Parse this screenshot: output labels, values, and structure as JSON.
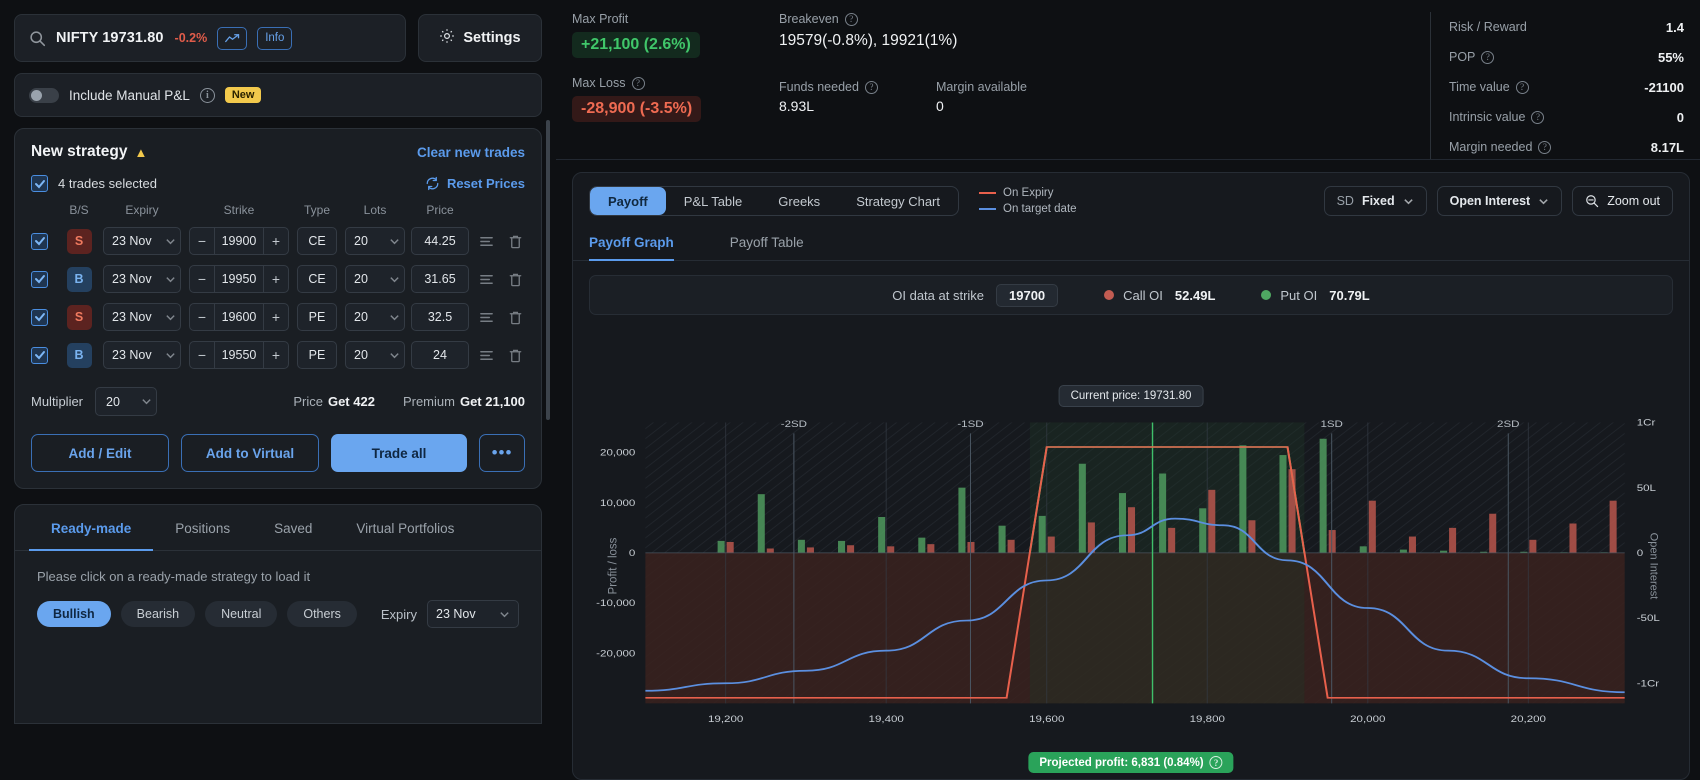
{
  "search": {
    "symbol": "NIFTY 19731.80",
    "change": "-0.2%",
    "info_label": "Info",
    "chart_icon": "trend-up-icon",
    "search_icon": "search-icon"
  },
  "settings": {
    "label": "Settings",
    "icon": "gear-icon"
  },
  "manual_pnl": {
    "label": "Include Manual P&L",
    "badge": "New",
    "toggle_state": "off"
  },
  "strategy": {
    "title": "New strategy",
    "clear_label": "Clear new trades",
    "selected_label": "4 trades selected",
    "reset_label": "Reset Prices",
    "columns": [
      "B/S",
      "Expiry",
      "Strike",
      "Type",
      "Lots",
      "Price"
    ],
    "trades": [
      {
        "bs": "S",
        "expiry": "23 Nov",
        "strike": "19900",
        "type": "CE",
        "lots": "20",
        "price": "44.25"
      },
      {
        "bs": "B",
        "expiry": "23 Nov",
        "strike": "19950",
        "type": "CE",
        "lots": "20",
        "price": "31.65"
      },
      {
        "bs": "S",
        "expiry": "23 Nov",
        "strike": "19600",
        "type": "PE",
        "lots": "20",
        "price": "32.5"
      },
      {
        "bs": "B",
        "expiry": "23 Nov",
        "strike": "19550",
        "type": "PE",
        "lots": "20",
        "price": "24"
      }
    ],
    "multiplier_label": "Multiplier",
    "multiplier_value": "20",
    "price_label": "Price",
    "price_value": "Get 422",
    "premium_label": "Premium",
    "premium_value": "Get 21,100",
    "buttons": {
      "add_edit": "Add / Edit",
      "add_virtual": "Add to Virtual",
      "trade_all": "Trade all",
      "more": "•••"
    }
  },
  "bottom": {
    "tabs": [
      "Ready-made",
      "Positions",
      "Saved",
      "Virtual Portfolios"
    ],
    "active_tab": "Ready-made",
    "hint": "Please click on a ready-made strategy to load it",
    "pills": [
      "Bullish",
      "Bearish",
      "Neutral",
      "Others"
    ],
    "active_pill": "Bullish",
    "expiry_label": "Expiry",
    "expiry_value": "23 Nov"
  },
  "stats": {
    "max_profit_label": "Max Profit",
    "max_profit_value": "+21,100 (2.6%)",
    "max_loss_label": "Max Loss",
    "max_loss_value": "-28,900 (-3.5%)",
    "breakeven_label": "Breakeven",
    "breakeven_value": "19579(-0.8%),  19921(1%)",
    "funds_label": "Funds needed",
    "funds_value": "8.93L",
    "margin_avail_label": "Margin available",
    "margin_avail_value": "0",
    "metrics": [
      {
        "key": "Risk / Reward",
        "value": "1.4",
        "help": false
      },
      {
        "key": "POP",
        "value": "55%",
        "help": true
      },
      {
        "key": "Time value",
        "value": "-21100",
        "help": true
      },
      {
        "key": "Intrinsic value",
        "value": "0",
        "help": true
      },
      {
        "key": "Margin needed",
        "value": "8.17L",
        "help": true
      }
    ]
  },
  "chart_panel": {
    "segments": [
      "Payoff",
      "P&L Table",
      "Greeks",
      "Strategy Chart"
    ],
    "active_segment": "Payoff",
    "legend": [
      {
        "label": "On Expiry",
        "color": "#e8604c"
      },
      {
        "label": "On target date",
        "color": "#5b8fe0"
      }
    ],
    "sd_prefix": "SD",
    "sd_value": "Fixed",
    "oi_dropdown": "Open Interest",
    "zoom_out": "Zoom out",
    "sub_tabs": [
      "Payoff Graph",
      "Payoff Table"
    ],
    "active_sub_tab": "Payoff Graph",
    "oi_strip": {
      "label": "OI data at strike",
      "strike": "19700",
      "call_label": "Call OI",
      "call_value": "52.49L",
      "call_color": "#c25c52",
      "put_label": "Put OI",
      "put_value": "70.79L",
      "put_color": "#4fa862"
    },
    "current_price_tag": "Current price: 19731.80",
    "projected_tag": "Projected profit: 6,831 (0.84%)"
  },
  "chart_data": {
    "type": "line",
    "title": "Payoff Graph",
    "xlabel": "",
    "ylabel": "Profit / loss",
    "y2label": "Open Interest",
    "xlim": [
      19100,
      20320
    ],
    "ylim": [
      -30000,
      26000
    ],
    "y_ticks": [
      20000,
      10000,
      0,
      -10000,
      -20000
    ],
    "y_tick_labels": [
      "20,000",
      "10,000",
      "0",
      "-10,000",
      "-20,000"
    ],
    "x_ticks": [
      19200,
      19400,
      19600,
      19800,
      20000,
      20200
    ],
    "x_tick_labels": [
      "19,200",
      "19,400",
      "19,600",
      "19,800",
      "20,000",
      "20,200"
    ],
    "y2_ticks": [
      10000000,
      5000000,
      0,
      -5000000,
      -10000000
    ],
    "y2_tick_labels": [
      "1Cr",
      "50L",
      "0",
      "-50L",
      "-1Cr"
    ],
    "sd_lines": [
      {
        "label": "-2SD",
        "x": 19285
      },
      {
        "label": "-1SD",
        "x": 19505
      },
      {
        "label": "1SD",
        "x": 19955
      },
      {
        "label": "2SD",
        "x": 20175
      }
    ],
    "current_price": 19731.8,
    "grid": true,
    "legend_position": "top-right",
    "series": [
      {
        "name": "On Expiry",
        "color": "#e8604c",
        "points": [
          [
            19100,
            -28900
          ],
          [
            19550,
            -28900
          ],
          [
            19600,
            21100
          ],
          [
            19900,
            21100
          ],
          [
            19950,
            -28900
          ],
          [
            20320,
            -28900
          ]
        ]
      },
      {
        "name": "On target date",
        "color": "#5b8fe0",
        "points": [
          [
            19100,
            -27500
          ],
          [
            19200,
            -26000
          ],
          [
            19300,
            -23500
          ],
          [
            19400,
            -19500
          ],
          [
            19500,
            -13500
          ],
          [
            19600,
            -5500
          ],
          [
            19700,
            3500
          ],
          [
            19760,
            6831
          ],
          [
            19820,
            5500
          ],
          [
            19900,
            -1500
          ],
          [
            20000,
            -11000
          ],
          [
            20100,
            -19500
          ],
          [
            20200,
            -25000
          ],
          [
            20320,
            -27800
          ]
        ]
      }
    ],
    "profit_zone": {
      "from": 19579,
      "to": 19921,
      "max": 21100
    },
    "open_interest_bars": {
      "call_color": "#b9564c",
      "put_color": "#4f9a5e",
      "strikes": [
        19200,
        19250,
        19300,
        19350,
        19400,
        19450,
        19500,
        19550,
        19600,
        19650,
        19700,
        19750,
        19800,
        19850,
        19900,
        19950,
        20000,
        20050,
        20100,
        20150,
        20200,
        20250,
        20300
      ],
      "call_oi": [
        2.0,
        0.8,
        1.0,
        1.4,
        1.2,
        1.6,
        2.0,
        2.4,
        3.0,
        5.6,
        8.4,
        4.6,
        11.6,
        6.0,
        15.4,
        4.2,
        9.6,
        3.0,
        4.6,
        7.2,
        2.4,
        5.4,
        9.6
      ],
      "put_oi": [
        2.2,
        10.8,
        2.4,
        2.2,
        6.6,
        2.8,
        12.0,
        5.0,
        6.8,
        16.4,
        11.0,
        14.6,
        8.2,
        19.8,
        18.0,
        21.0,
        1.2,
        0.6,
        0.4,
        0.2,
        0.2,
        0.1,
        0.1
      ]
    }
  }
}
